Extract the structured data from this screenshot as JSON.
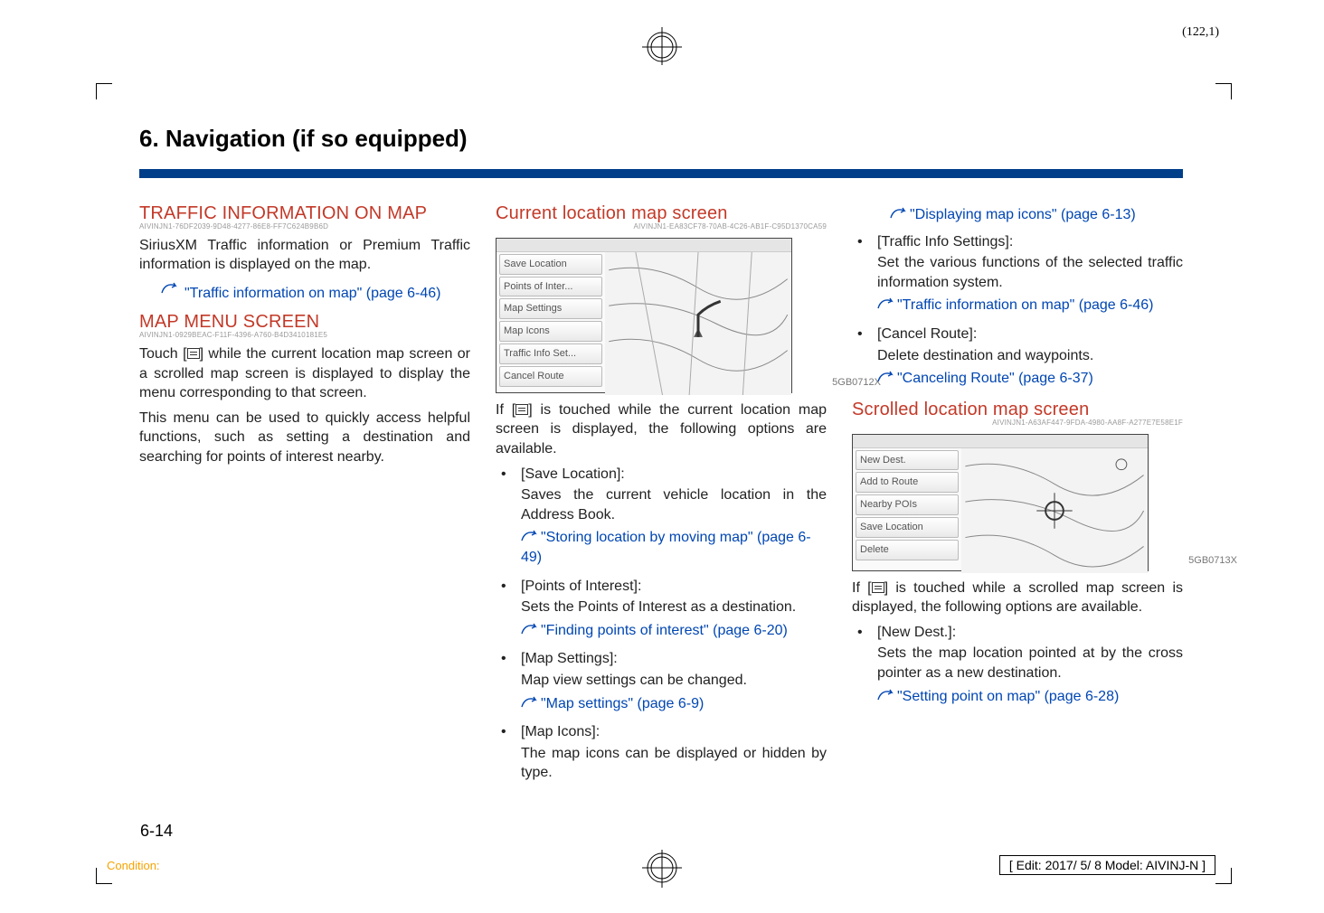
{
  "page_annotation": "(122,1)",
  "section_title": "6. Navigation (if so equipped)",
  "page_number": "6-14",
  "condition_label": "Condition:",
  "edit_stamp": "[ Edit: 2017/ 5/ 8    Model:  AIVINJ-N ]",
  "col1": {
    "h1": "TRAFFIC INFORMATION ON MAP",
    "h1_code": "AIVINJN1-76DF2039-9D48-4277-86E8-FF7C624B9B6D",
    "p1": "SiriusXM Traffic information or Premium Traffic information is displayed on the map.",
    "ref1": "\"Traffic information on map\" (page 6-46)",
    "h2": "MAP MENU SCREEN",
    "h2_code": "AIVINJN1-0929BEAC-F11F-4396-A760-B4D3410181E5",
    "p2a": "Touch [",
    "p2b": "] while the current location map screen or a scrolled map screen is displayed to display the menu corresponding to that screen.",
    "p3": "This menu can be used to quickly access helpful functions, such as setting a destination and searching for points of interest nearby."
  },
  "col2": {
    "h1": "Current location map screen",
    "h1_code": "AIVINJN1-EA83CF78-70AB-4C26-AB1F-C95D1370CA59",
    "diagram_label": "5GB0712X",
    "menu_items": [
      "Save Location",
      "Points of Inter...",
      "Map Settings",
      "Map Icons",
      "Traffic Info Set...",
      "Cancel Route"
    ],
    "p1a": "If [",
    "p1b": "] is touched while the current location map screen is displayed, the following options are available.",
    "items": [
      {
        "title": "[Save Location]:",
        "body": "Saves the current vehicle location in the Address Book.",
        "ref": "\"Storing location by moving map\" (page 6-49)"
      },
      {
        "title": "[Points of Interest]:",
        "body": "Sets the Points of Interest as a destination.",
        "ref": "\"Finding points of interest\" (page 6-20)"
      },
      {
        "title": "[Map Settings]:",
        "body": "Map view settings can be changed.",
        "ref": "\"Map settings\" (page 6-9)"
      },
      {
        "title": "[Map Icons]:",
        "body": "The map icons can be displayed or hidden by type."
      }
    ]
  },
  "col3": {
    "top_ref": "\"Displaying map icons\" (page 6-13)",
    "items_top": [
      {
        "title": "[Traffic Info Settings]:",
        "body": "Set the various functions of the selected traffic information system.",
        "ref": "\"Traffic information on map\" (page 6-46)"
      },
      {
        "title": "[Cancel Route]:",
        "body": "Delete destination and waypoints.",
        "ref": "\"Canceling Route\" (page 6-37)"
      }
    ],
    "h1": "Scrolled location map screen",
    "h1_code": "AIVINJN1-A63AF447-9FDA-4980-AA8F-A277E7E58E1F",
    "diagram_label": "5GB0713X",
    "menu_items": [
      "New Dest.",
      "Add to Route",
      "Nearby POIs",
      "Save Location",
      "Delete"
    ],
    "p1a": "If [",
    "p1b": "] is touched while a scrolled map screen is displayed, the following options are available.",
    "items": [
      {
        "title": "[New Dest.]:",
        "body": "Sets the map location pointed at by the cross pointer as a new destination.",
        "ref": "\"Setting point on map\" (page 6-28)"
      }
    ]
  }
}
